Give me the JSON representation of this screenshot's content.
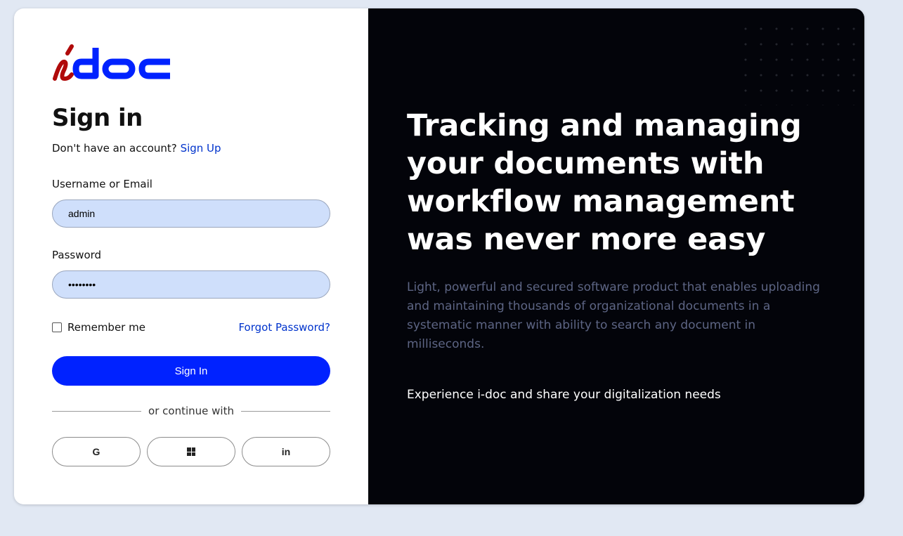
{
  "logo": {
    "text": "idoc",
    "colors": {
      "i": "#b00a0a",
      "doc": "#0022ff"
    }
  },
  "form": {
    "title": "Sign in",
    "no_account_text": "Don't have an account?",
    "signup_link": "Sign Up",
    "username_label": "Username or Email",
    "username_value": "admin",
    "password_label": "Password",
    "password_value": "password",
    "remember_label": "Remember me",
    "forgot_link": "Forgot Password?",
    "submit_label": "Sign In",
    "divider_text": "or continue with",
    "social": [
      {
        "name": "google",
        "icon": "google-icon",
        "glyph": "G"
      },
      {
        "name": "windows",
        "icon": "windows-icon"
      },
      {
        "name": "linkedin",
        "icon": "linkedin-icon",
        "glyph": "in"
      }
    ]
  },
  "promo": {
    "headline": "Tracking and managing your documents with workflow management was never more easy",
    "description": "Light, powerful and secured software product that enables uploading and maintaining thousands of organizational documents in a systematic manner with ability to search any document in milliseconds.",
    "tagline": "Experience i-doc and share your digitalization needs"
  },
  "colors": {
    "primary": "#0022ff",
    "link": "#0033cc",
    "input_bg": "#cfdffb",
    "panel_dark": "#03040a",
    "muted_text": "#5d6584"
  }
}
